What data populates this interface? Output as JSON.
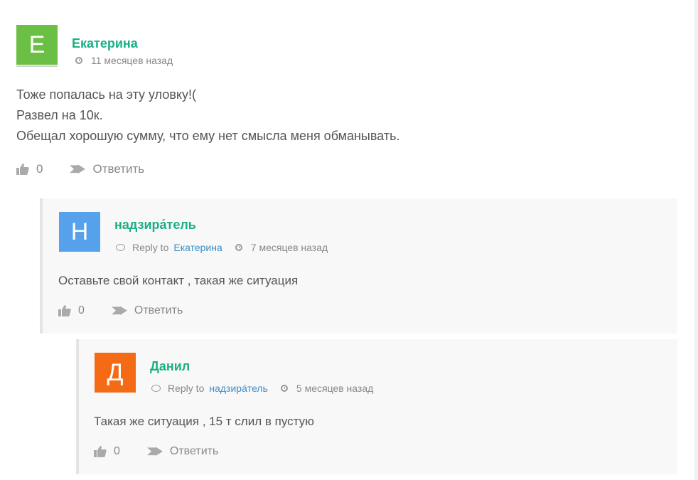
{
  "comments": [
    {
      "avatar_letter": "Е",
      "avatar_color": "#6cbf45",
      "author": "Екатерина",
      "time": "11 месяцев назад",
      "text_lines": [
        "Тоже попалась на эту уловку!(",
        "Развел на 10к.",
        "Обещал хорошую сумму, что ему нет смысла меня обманывать."
      ],
      "likes": "0",
      "reply_label": "Ответить"
    },
    {
      "avatar_letter": "Н",
      "avatar_color": "#55a1ec",
      "author": "надзира́тель",
      "reply_to_label": "Reply to",
      "reply_to_name": "Екатерина",
      "time": "7 месяцев назад",
      "text": "Оставьте свой контакт , такая же ситуация",
      "likes": "0",
      "reply_label": "Ответить"
    },
    {
      "avatar_letter": "Д",
      "avatar_color": "#f56a14",
      "author": "Данил",
      "reply_to_label": "Reply to",
      "reply_to_name": "надзира́тель",
      "time": "5 месяцев назад",
      "text": "Такая же ситуация , 15 т слил в пустую",
      "likes": "0",
      "reply_label": "Ответить"
    }
  ]
}
